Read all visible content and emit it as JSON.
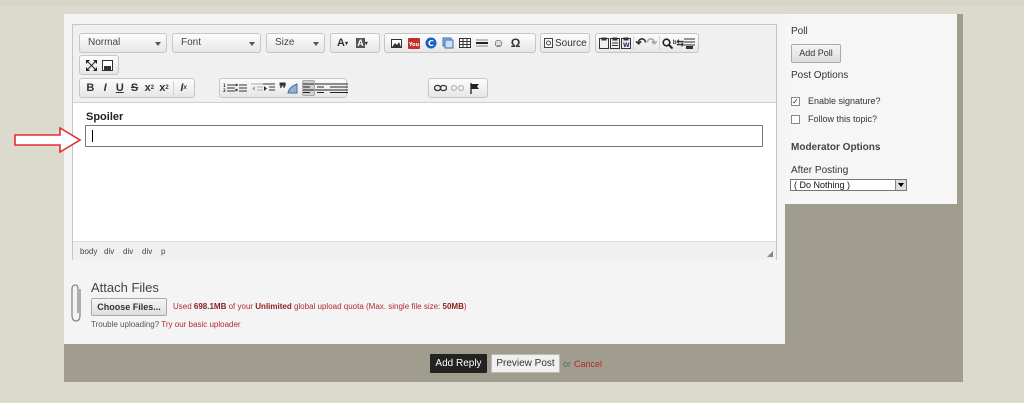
{
  "editor": {
    "combos": {
      "format": "Normal",
      "font": "Font",
      "size": "Size"
    },
    "source_label": "Source",
    "spoiler_title": "Spoiler",
    "path_items": [
      "body",
      "div",
      "div",
      "div",
      "p"
    ]
  },
  "attach": {
    "title": "Attach Files",
    "choose_button": "Choose Files...",
    "quota_prefix": "Used ",
    "quota_used": "698.1MB",
    "quota_mid": " of your ",
    "quota_limit": "Unlimited",
    "quota_suffix": " global upload quota (Max. single file size: ",
    "max_size": "50MB",
    "quota_end": ")",
    "trouble_text": "Trouble uploading? ",
    "basic_uploader_link": "Try our basic uploader"
  },
  "sidebar": {
    "poll_title": "Poll",
    "add_poll_button": "Add Poll",
    "post_options_title": "Post Options",
    "enable_signature": {
      "label": "Enable signature?",
      "checked": true
    },
    "follow_topic": {
      "label": "Follow this topic?",
      "checked": false
    },
    "moderator_options_title": "Moderator Options",
    "after_posting_label": "After Posting",
    "after_posting_value": "( Do Nothing )"
  },
  "actions": {
    "add_reply": "Add Reply",
    "preview_post": "Preview Post",
    "or_text": "or",
    "cancel": "Cancel"
  },
  "colors": {
    "arrow": "#e03030",
    "link": "#b12a2a",
    "frame": "#a09d8f"
  }
}
